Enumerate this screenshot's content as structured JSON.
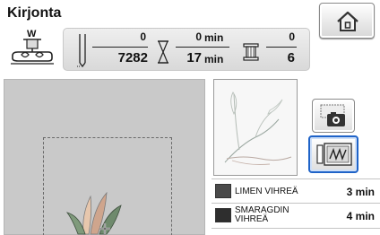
{
  "screen": {
    "title": "Kirjonta"
  },
  "home_button": {
    "icon": "home-icon"
  },
  "presser_foot": {
    "code": "W",
    "icon": "presser-foot-icon"
  },
  "status": {
    "needle": {
      "current": "0",
      "total": "7282",
      "icon": "needle-icon"
    },
    "time": {
      "current": "0",
      "total": "17",
      "unit": "min",
      "icon": "hourglass-icon"
    },
    "thread_changes": {
      "current": "0",
      "total": "6",
      "icon": "spool-icon"
    }
  },
  "side_buttons": [
    {
      "name": "scan-button",
      "icon": "camera-icon",
      "selected": false
    },
    {
      "name": "stitch-view-button",
      "icon": "stitch-preview-icon",
      "selected": true
    }
  ],
  "color_list": [
    {
      "name": "LIMEN VIHREÄ",
      "time": "3 min",
      "color": "#4a4a4a"
    },
    {
      "name": "SMARAGDIN VIHREÄ",
      "time": "4 min",
      "color": "#2e2e2e"
    }
  ],
  "colors": {
    "selection_border": "#1f63c8",
    "edit_area": "#c9c9c9",
    "panel": "#e3e3e3"
  }
}
